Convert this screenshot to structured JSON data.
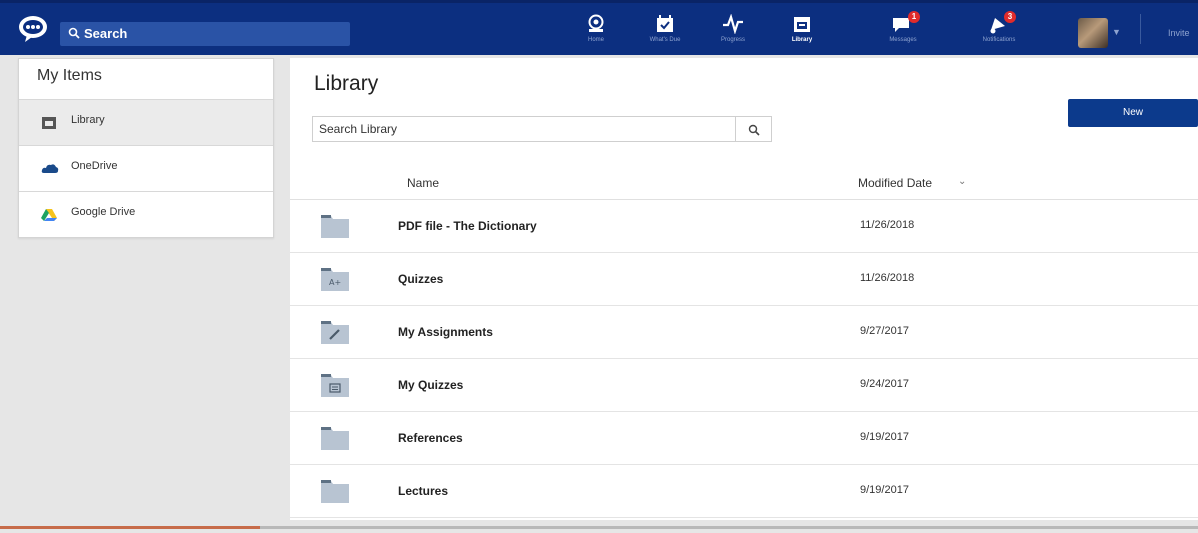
{
  "topbar": {
    "search_label": "Search",
    "nav": [
      {
        "label": "Home",
        "icon": "home-icon"
      },
      {
        "label": "What's Due",
        "icon": "calendar-check-icon"
      },
      {
        "label": "Progress",
        "icon": "pulse-icon"
      },
      {
        "label": "Library",
        "icon": "library-icon"
      },
      {
        "label": "Messages",
        "icon": "messages-icon",
        "badge": "1"
      },
      {
        "label": "Notifications",
        "icon": "notifications-icon",
        "badge": "3"
      }
    ],
    "invite_label": "Invite",
    "colors": {
      "bar": "#0c2f80",
      "search": "#2a53a6",
      "badge": "#e02b2b"
    }
  },
  "sidebar": {
    "title": "My Items",
    "items": [
      {
        "label": "Library",
        "icon": "library-icon",
        "selected": true
      },
      {
        "label": "OneDrive",
        "icon": "onedrive-icon",
        "selected": false
      },
      {
        "label": "Google Drive",
        "icon": "google-drive-icon",
        "selected": false
      }
    ]
  },
  "main": {
    "title": "Library",
    "search_placeholder": "Search Library",
    "new_button": "New",
    "columns": {
      "name": "Name",
      "modified": "Modified Date"
    },
    "rows": [
      {
        "name": "PDF file - The Dictionary",
        "date": "11/26/2018",
        "icon": "folder-icon"
      },
      {
        "name": "Quizzes",
        "date": "11/26/2018",
        "icon": "folder-a-plus-icon"
      },
      {
        "name": "My Assignments",
        "date": "9/27/2017",
        "icon": "folder-pencil-icon"
      },
      {
        "name": "My Quizzes",
        "date": "9/24/2017",
        "icon": "folder-list-icon"
      },
      {
        "name": "References",
        "date": "9/19/2017",
        "icon": "folder-icon"
      },
      {
        "name": "Lectures",
        "date": "9/19/2017",
        "icon": "folder-icon"
      }
    ]
  }
}
